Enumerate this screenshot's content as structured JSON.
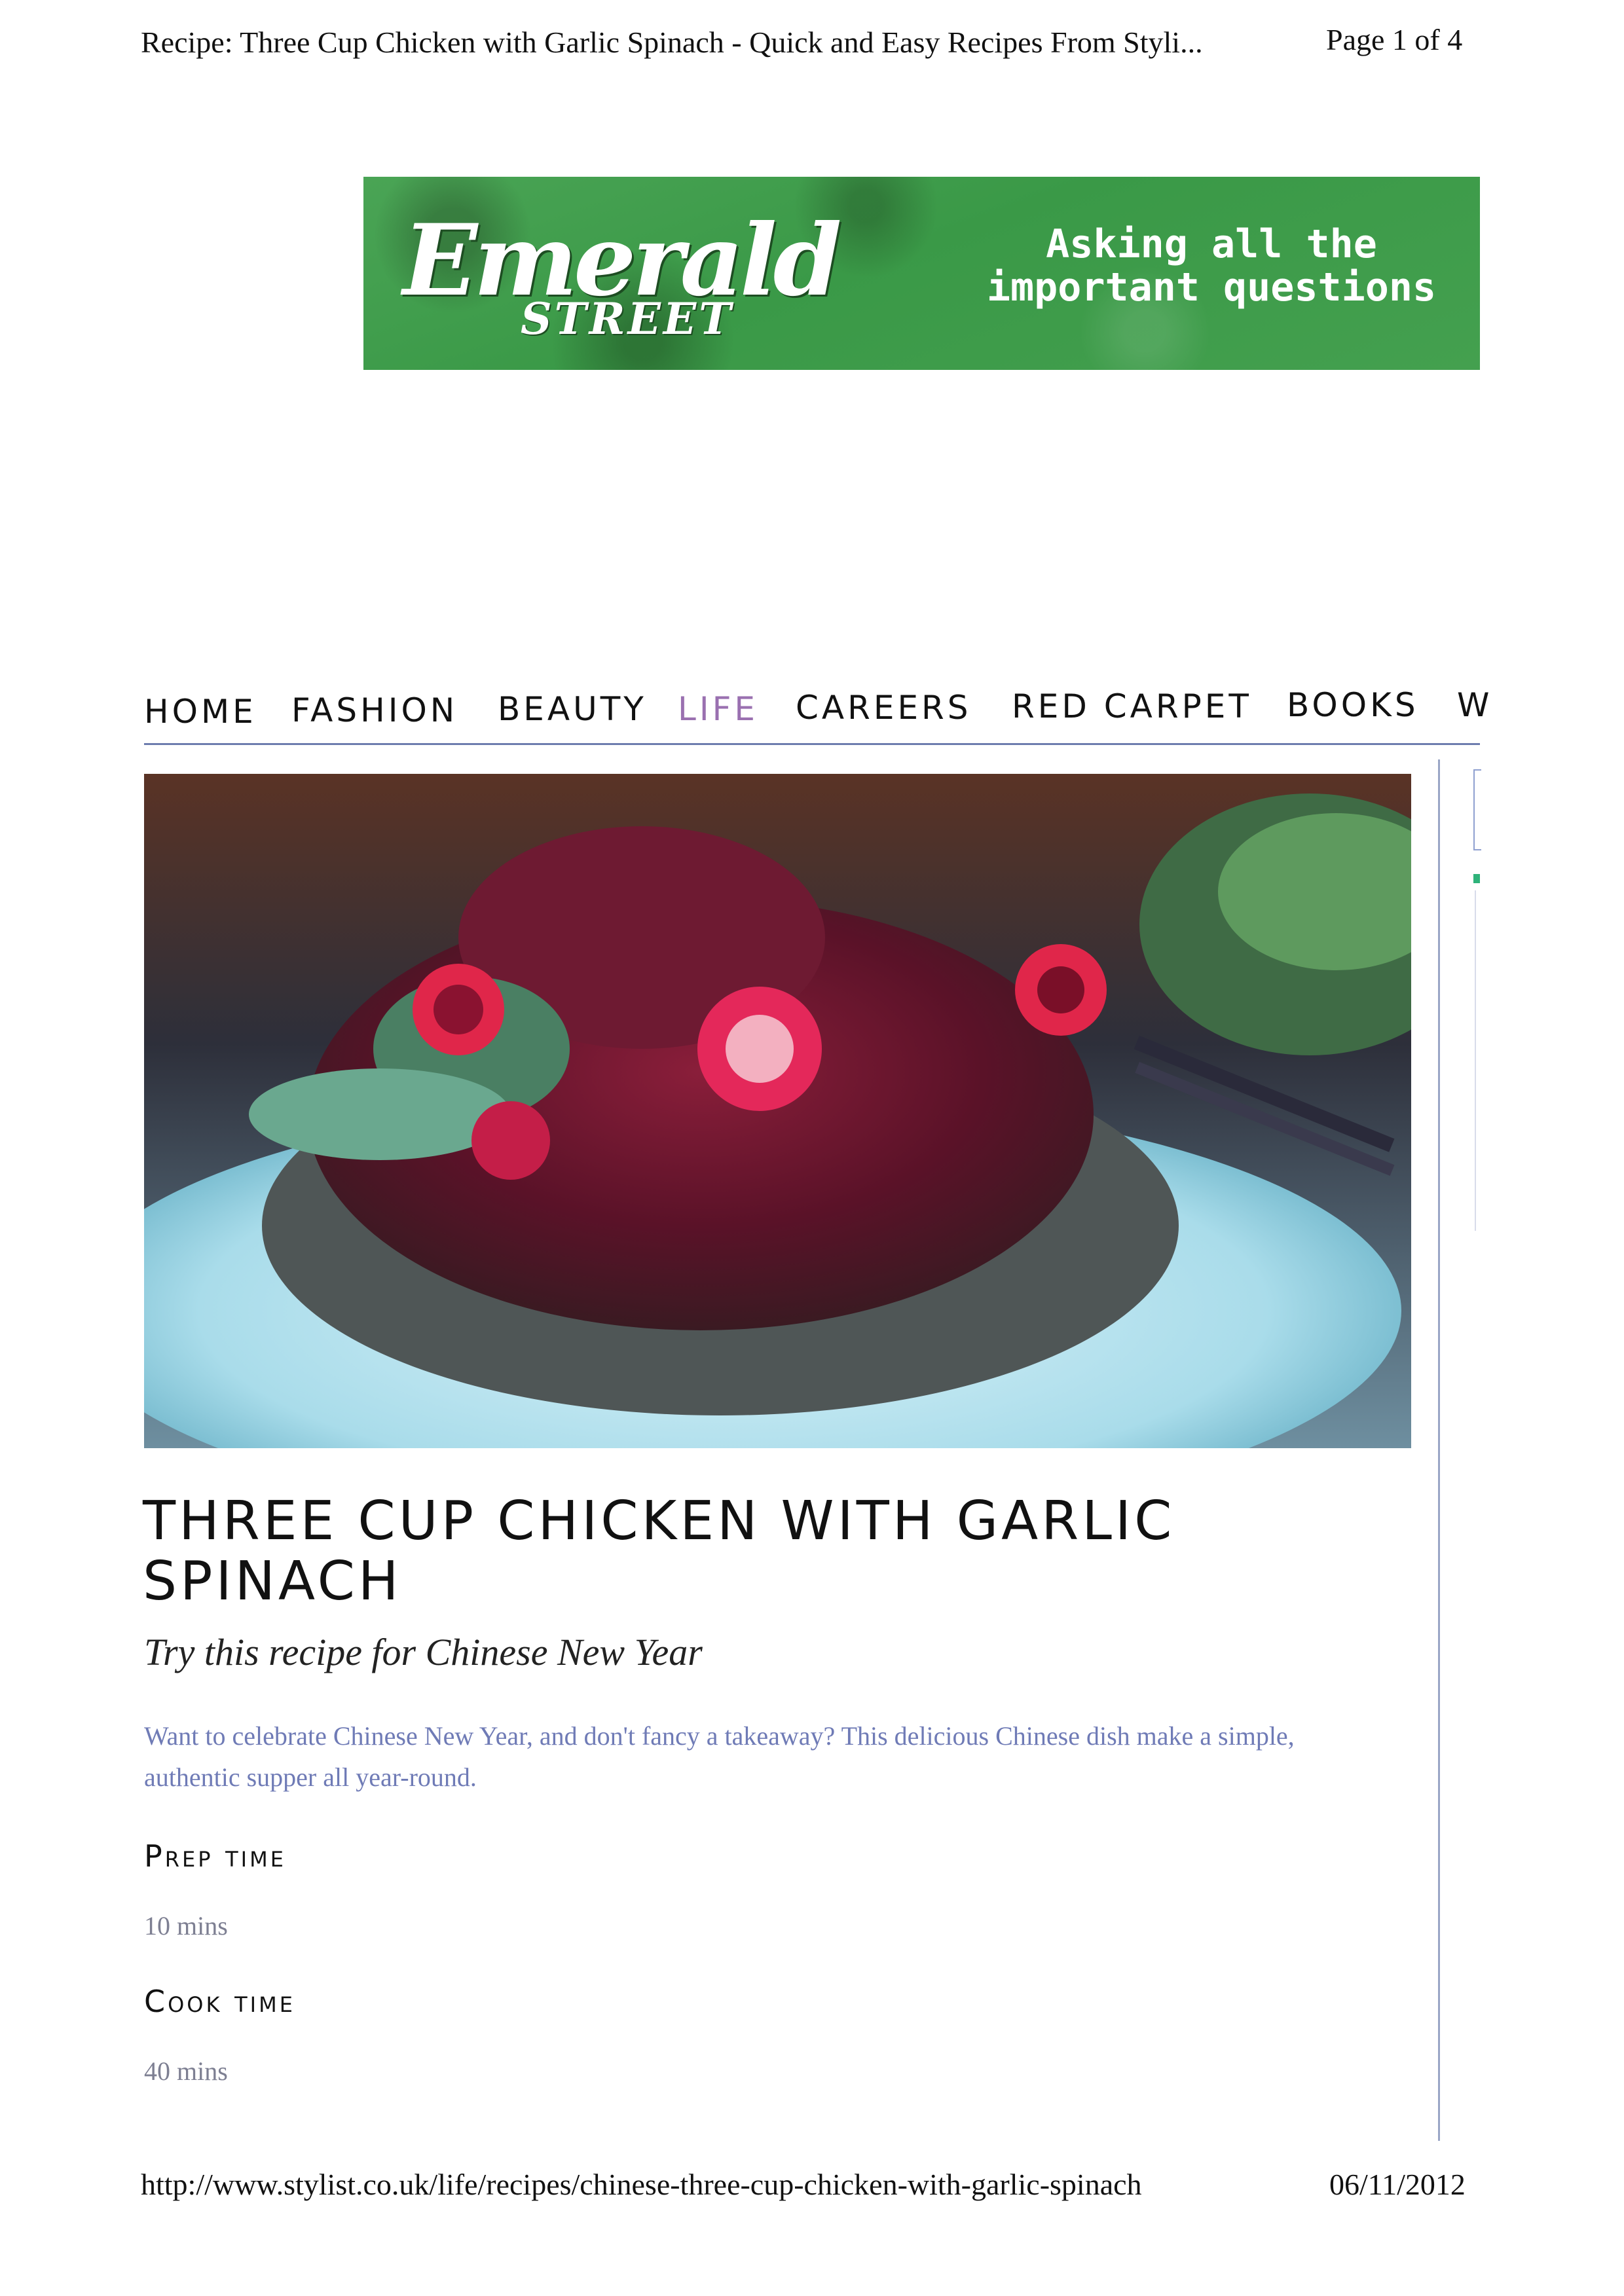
{
  "print_header": {
    "title": "Recipe: Three Cup Chicken with Garlic Spinach - Quick and Easy Recipes From Styli...",
    "page": "Page 1 of 4"
  },
  "banner": {
    "logo_word": "Emerald",
    "logo_street": "STREET",
    "tagline_line1": "Asking all the",
    "tagline_line2": "important questions",
    "color": "#3f9f4b"
  },
  "nav": {
    "items": [
      "HOME",
      "FASHION",
      "BEAUTY",
      "LIFE",
      "CAREERS",
      "RED CARPET",
      "BOOKS",
      "W"
    ],
    "active": "LIFE",
    "active_color": "#9a70b0"
  },
  "article": {
    "title": "THREE CUP CHICKEN WITH GARLIC SPINACH",
    "subtitle": "Try this recipe for Chinese New Year",
    "intro": "Want to celebrate Chinese New Year, and don't fancy a takeaway? This delicious Chinese dish make a simple, authentic supper all year-round.",
    "prep_label": "Prep time",
    "prep_value": "10 mins",
    "cook_label": "Cook time",
    "cook_value": "40 mins"
  },
  "print_footer": {
    "url": "http://www.stylist.co.uk/life/recipes/chinese-three-cup-chicken-with-garlic-spinach",
    "date": "06/11/2012"
  }
}
